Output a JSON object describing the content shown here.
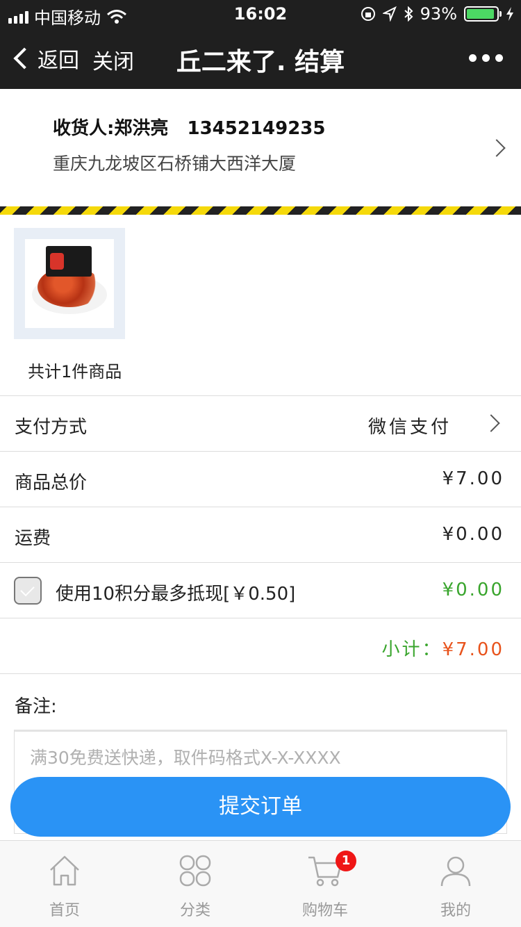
{
  "status_bar": {
    "carrier": "中国移动",
    "time": "16:02",
    "battery_text": "93%",
    "battery_level": 0.93
  },
  "nav": {
    "back_label": "返回",
    "close_label": "关闭",
    "title": "丘二来了. 结算"
  },
  "address": {
    "receiver_label": "收货人:",
    "receiver_name": "郑洪亮",
    "phone": "13452149235",
    "address_line": "重庆九龙坡区石桥铺大西洋大厦"
  },
  "product": {
    "count_text": "共计1件商品"
  },
  "payment": {
    "label": "支付方式",
    "value": "微信支付"
  },
  "total": {
    "label": "商品总价",
    "value": "¥7.00"
  },
  "shipping": {
    "label": "运费",
    "value": "¥0.00"
  },
  "points": {
    "label": "使用10积分最多抵现[￥0.50]",
    "value": "¥0.00",
    "checked": false
  },
  "subtotal": {
    "label": "小计：",
    "value": "¥7.00"
  },
  "note": {
    "label": "备注:",
    "placeholder": "满30免费送快递，取件码格式X-X-XXXX"
  },
  "submit_label": "提交订单",
  "tabs": [
    {
      "label": "首页",
      "icon": "home-icon"
    },
    {
      "label": "分类",
      "icon": "category-icon"
    },
    {
      "label": "购物车",
      "icon": "cart-icon",
      "badge": "1"
    },
    {
      "label": "我的",
      "icon": "user-icon"
    }
  ],
  "colors": {
    "accent_blue": "#2a93f5",
    "green": "#39a52d",
    "orange": "#e8531c",
    "badge_red": "#ef1616"
  }
}
